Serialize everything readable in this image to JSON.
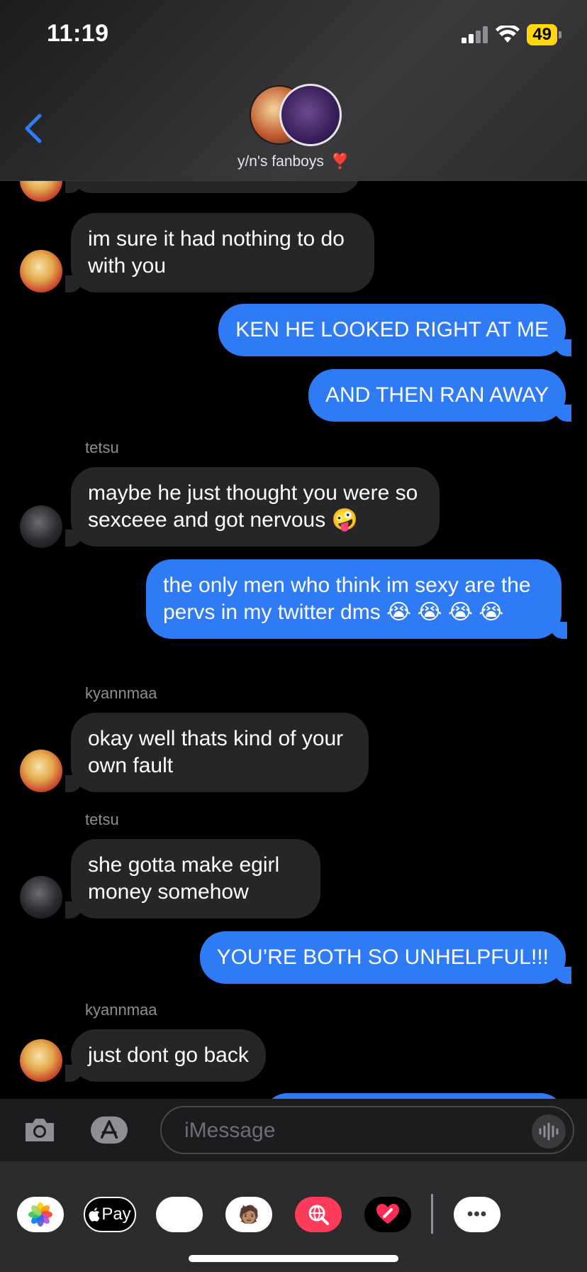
{
  "status_bar": {
    "time": "11:19",
    "battery": "49"
  },
  "header": {
    "group_name": "y/n's fanboys",
    "heart": "❣️"
  },
  "messages": [
    {
      "from": "kenma",
      "text": "im sure it had nothing to do with you"
    },
    {
      "from": "me",
      "text": "KEN HE LOOKED RIGHT AT ME"
    },
    {
      "from": "me",
      "text": "AND THEN RAN AWAY"
    },
    {
      "sender_label": "tetsu",
      "from": "tetsu",
      "text": "maybe he just thought you were so sexceee and got nervous 🤪"
    },
    {
      "from": "me",
      "text": "the only men who think im sexy are the pervs in my twitter dms 😭 😭 😭 😭"
    },
    {
      "sender_label": "kyannmaa",
      "from": "kenma",
      "text": "okay well thats kind of your own fault"
    },
    {
      "sender_label": "tetsu",
      "from": "tetsu",
      "text": "she gotta make egirl money somehow"
    },
    {
      "from": "me",
      "text": "YOU’RE BOTH SO UNHELPFUL!!!"
    },
    {
      "sender_label": "kyannmaa",
      "from": "kenma",
      "text": "just dont go back"
    }
  ],
  "input": {
    "placeholder": "iMessage"
  },
  "apps": [
    {
      "name": "photos",
      "label": ""
    },
    {
      "name": "apple-pay",
      "label": "Pay"
    },
    {
      "name": "animoji",
      "label": "🐵"
    },
    {
      "name": "memoji",
      "label": "🧑🏽"
    },
    {
      "name": "search-images",
      "label": ""
    },
    {
      "name": "digital-touch",
      "label": ""
    },
    {
      "name": "more",
      "label": "•••"
    }
  ],
  "colors": {
    "outgoing": "#2f7bf6",
    "incoming": "#262628",
    "accent": "#2f7bf6"
  }
}
